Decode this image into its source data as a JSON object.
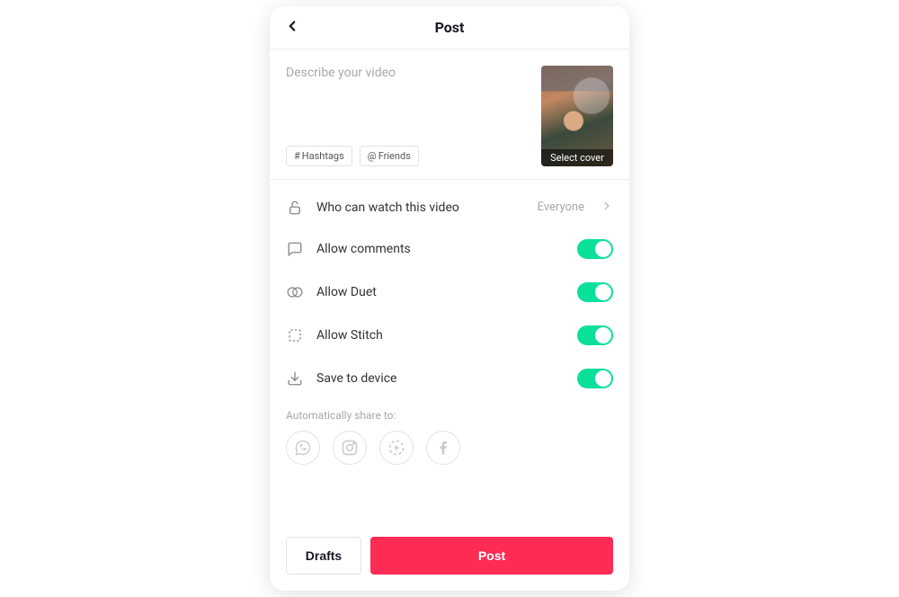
{
  "header": {
    "title": "Post"
  },
  "caption": {
    "placeholder": "Describe your video",
    "value": "",
    "hashtags_chip": "Hashtags",
    "friends_chip": "Friends",
    "select_cover_label": "Select cover"
  },
  "settings": {
    "privacy": {
      "label": "Who can watch this video",
      "value": "Everyone"
    },
    "comments": {
      "label": "Allow comments",
      "enabled": true
    },
    "duet": {
      "label": "Allow Duet",
      "enabled": true
    },
    "stitch": {
      "label": "Allow Stitch",
      "enabled": true
    },
    "save": {
      "label": "Save to device",
      "enabled": true
    }
  },
  "share": {
    "label": "Automatically share to:"
  },
  "buttons": {
    "drafts": "Drafts",
    "post": "Post"
  }
}
